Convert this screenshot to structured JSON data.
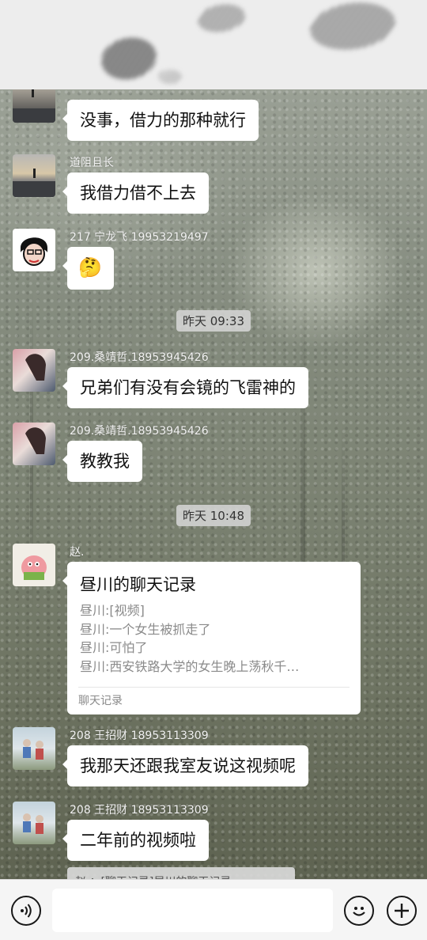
{
  "messages": [
    {
      "text": "没事，借力的那种就行"
    },
    {
      "sender": "道阻且长",
      "text": "我借力借不上去"
    },
    {
      "sender": "217 宁龙飞 19953219497",
      "text": "🤔"
    },
    {
      "time": "昨天 09:33"
    },
    {
      "sender": "209.桑靖哲.18953945426",
      "text": "兄弟们有没有会镜的飞雷神的"
    },
    {
      "sender": "209.桑靖哲.18953945426",
      "text": "教教我"
    },
    {
      "time": "昨天 10:48"
    },
    {
      "sender": "赵."
    },
    {
      "sender": "208 王招财 18953113309",
      "text": "我那天还跟我室友说这视频呢"
    },
    {
      "sender": "208 王招财 18953113309",
      "text": "二年前的视频啦"
    }
  ],
  "record_card": {
    "title": "昼川的聊天记录",
    "lines": [
      "昼川:[视频]",
      "昼川:一个女生被抓走了",
      "昼川:可怕了",
      "昼川:西安铁路大学的女生晚上荡秋千…"
    ],
    "footer": "聊天记录"
  },
  "quote_preview": "赵.：[聊天记录]昼川的聊天记录",
  "input_bar": {
    "voice_icon": "voice-icon",
    "emoji_icon": "emoji-icon",
    "more_icon": "plus-icon"
  }
}
